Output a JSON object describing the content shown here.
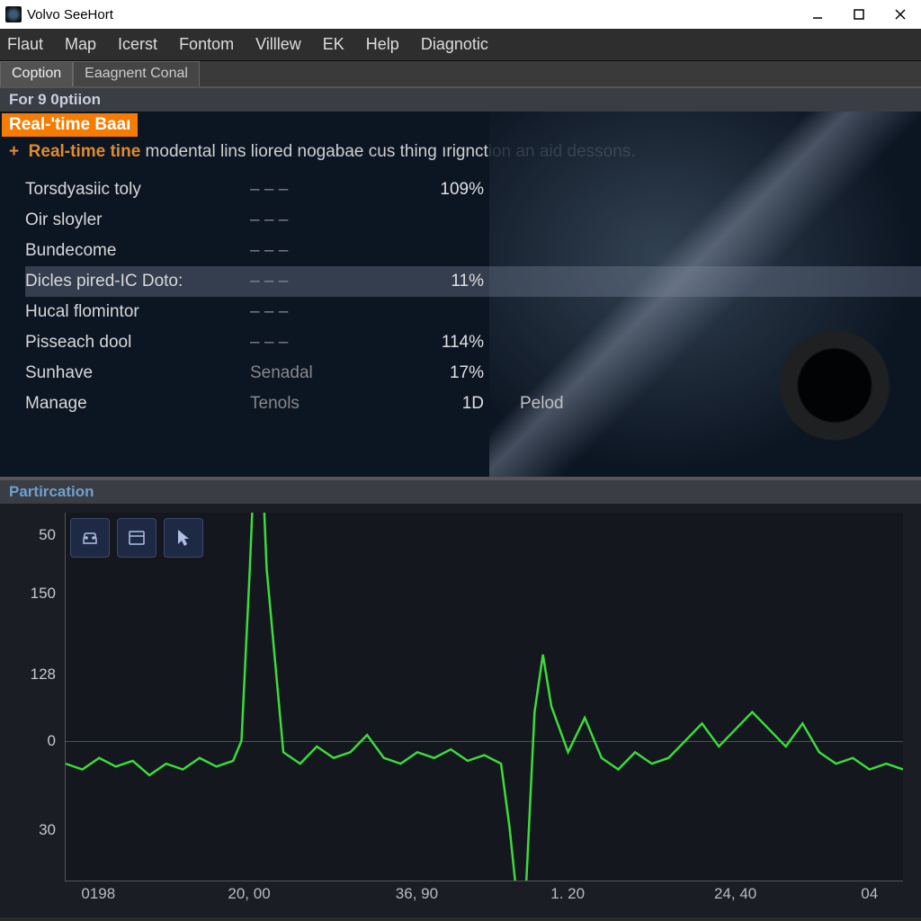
{
  "window": {
    "title": "Volvo SeeHort"
  },
  "menu": {
    "items": [
      "Flaut",
      "Map",
      "Icerst",
      "Fontom",
      "Villlew",
      "EK",
      "Help",
      "Diagnotic"
    ]
  },
  "tabs": {
    "items": [
      {
        "label": "Coption",
        "active": true
      },
      {
        "label": "Eaagnent Conal",
        "active": false
      }
    ]
  },
  "section_header": "For 9 0ptiion",
  "realtime": {
    "badge": "Real-'time Baaı",
    "plus": "+",
    "lead": "Real-time tine",
    "desc": " modental lins liored nogabae cus thing ırignction an aid dessons."
  },
  "table": {
    "rows": [
      {
        "name": "Torsdyasiic toly",
        "col2": "– – –",
        "col3": "109%",
        "col4": "",
        "selected": false
      },
      {
        "name": "Oir sloyler",
        "col2": "– – –",
        "col3": "",
        "col4": "",
        "selected": false
      },
      {
        "name": "Bundecome",
        "col2": "– – –",
        "col3": "",
        "col4": "",
        "selected": false
      },
      {
        "name": "Dicles pired-IC Doto:",
        "col2": "– – –",
        "col3": "11%",
        "col4": "",
        "selected": true
      },
      {
        "name": "Hucal flomintor",
        "col2": "– – –",
        "col3": "",
        "col4": "",
        "selected": false
      },
      {
        "name": "Pisseach dool",
        "col2": "– – –",
        "col3": "114%",
        "col4": "",
        "selected": false
      },
      {
        "name": "Sunhave",
        "col2": "Senadal",
        "col3": "17%",
        "col4": "",
        "selected": false
      },
      {
        "name": "Manage",
        "col2": "Tenols",
        "col3": "1D",
        "col4": "Pelod",
        "selected": false
      }
    ]
  },
  "chart": {
    "title": "Partircation",
    "toolbar_icons": [
      "car-front-icon",
      "panel-icon",
      "cursor-icon"
    ],
    "toolbar_right_icon": "car-front-icon"
  },
  "chart_data": {
    "type": "line",
    "title": "Partircation",
    "xlabel": "",
    "ylabel": "",
    "y_ticks": [
      50,
      150,
      128,
      0,
      30
    ],
    "x_ticks": [
      "0198",
      "20, 00",
      "36, 90",
      "1. 20",
      "24, 40",
      "04"
    ],
    "ylim": [
      -60,
      160
    ],
    "series": [
      {
        "name": "trace",
        "color": "#3bdc3b",
        "x": [
          0,
          2,
          4,
          6,
          8,
          10,
          12,
          14,
          16,
          18,
          20,
          21,
          22,
          23,
          24,
          26,
          28,
          30,
          32,
          34,
          36,
          38,
          40,
          42,
          44,
          46,
          48,
          50,
          52,
          53,
          54,
          55,
          56,
          57,
          58,
          60,
          62,
          64,
          66,
          68,
          70,
          72,
          74,
          76,
          78,
          80,
          82,
          84,
          86,
          88,
          90,
          92,
          94,
          96,
          98,
          100
        ],
        "y": [
          -8,
          -10,
          -6,
          -9,
          -7,
          -12,
          -8,
          -10,
          -6,
          -9,
          -7,
          0,
          60,
          130,
          60,
          -4,
          -8,
          -2,
          -6,
          -4,
          2,
          -6,
          -8,
          -4,
          -6,
          -3,
          -7,
          -5,
          -8,
          -30,
          -58,
          -50,
          10,
          30,
          12,
          -4,
          8,
          -6,
          -10,
          -4,
          -8,
          -6,
          0,
          6,
          -2,
          4,
          10,
          4,
          -2,
          6,
          -4,
          -8,
          -6,
          -10,
          -8,
          -10
        ]
      }
    ]
  }
}
